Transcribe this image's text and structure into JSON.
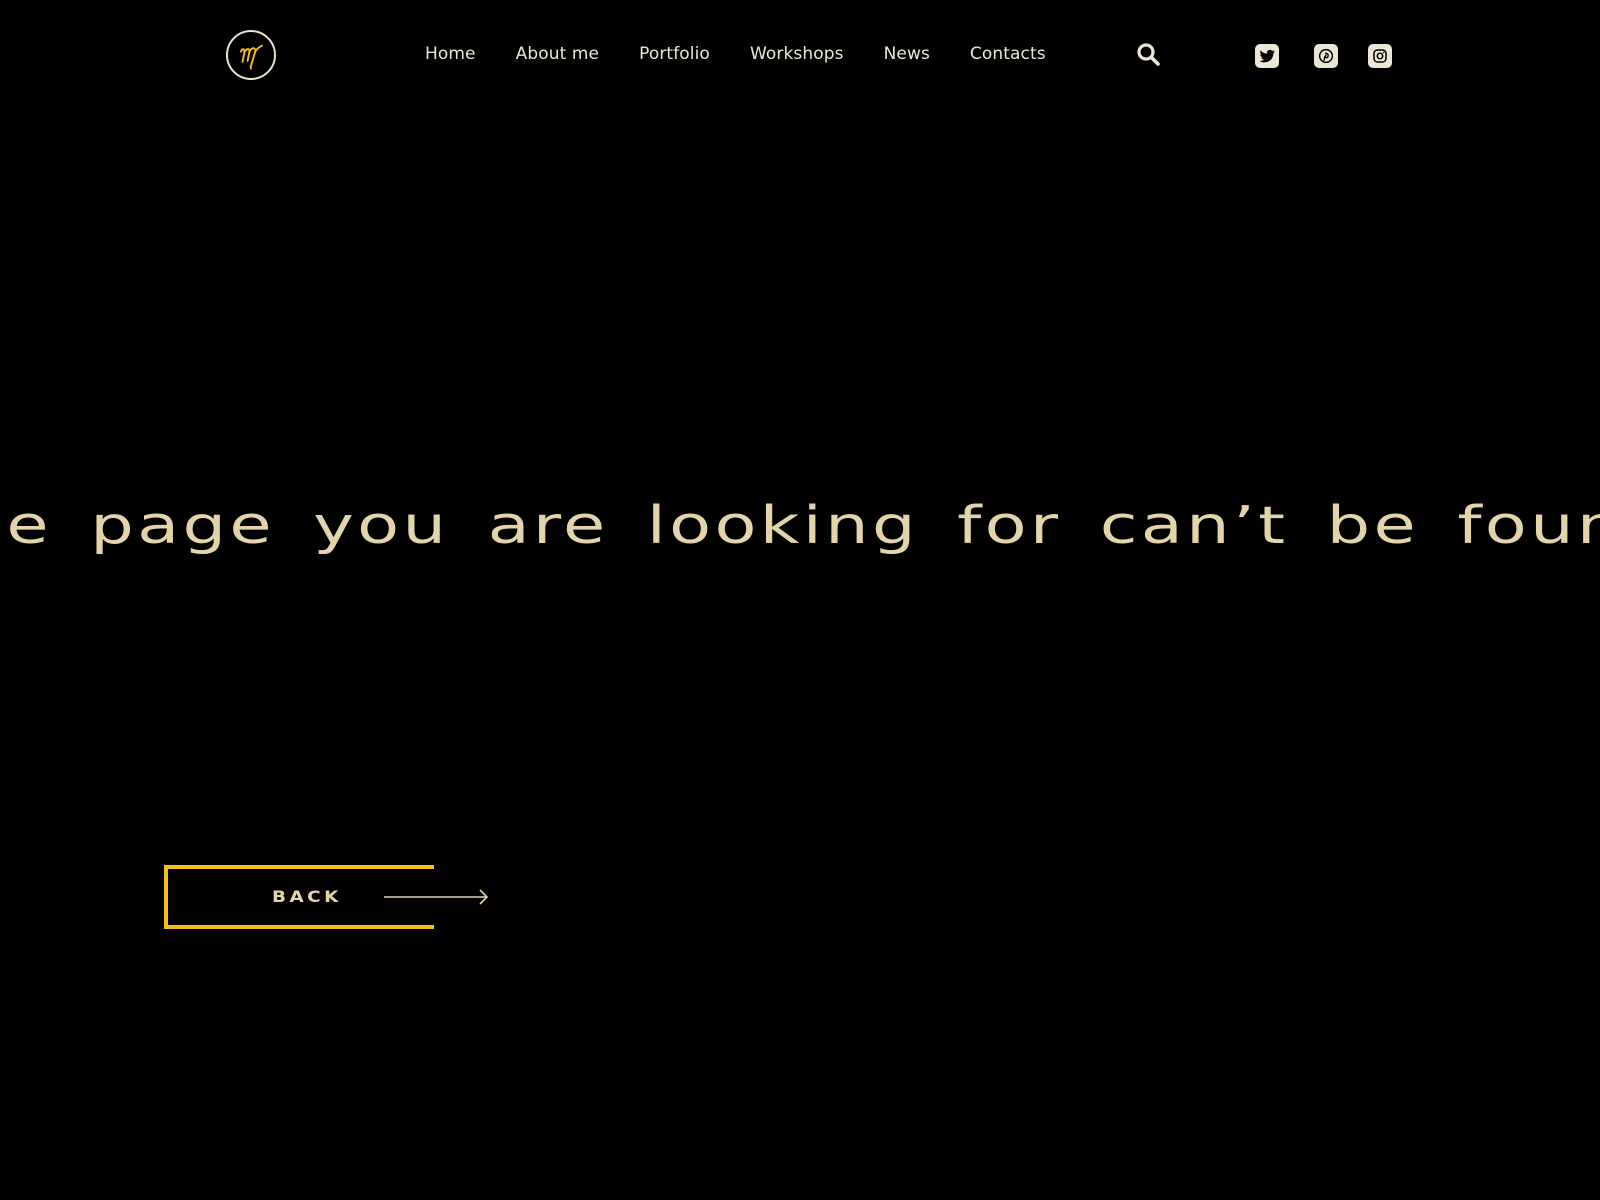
{
  "header": {
    "logo_alt": "M",
    "nav": [
      {
        "label": "Home"
      },
      {
        "label": "About me"
      },
      {
        "label": "Portfolio"
      },
      {
        "label": "Workshops"
      },
      {
        "label": "News"
      },
      {
        "label": "Contacts"
      }
    ],
    "search_icon": "search-icon",
    "social": [
      {
        "name": "twitter",
        "icon": "twitter-icon"
      },
      {
        "name": "pinterest",
        "icon": "pinterest-icon"
      },
      {
        "name": "instagram",
        "icon": "instagram-icon"
      }
    ]
  },
  "main": {
    "headline": "the page you are looking for can’t be found",
    "back_button": {
      "label": "BACK",
      "icon": "arrow-right-icon"
    }
  },
  "colors": {
    "background": "#000000",
    "accent": "#f3c01a",
    "text_light": "#ece6d6",
    "headline": "#e3d5a9"
  }
}
